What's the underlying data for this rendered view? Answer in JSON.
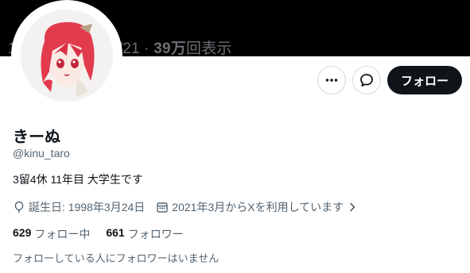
{
  "banner": {
    "overlay_prefix": "1",
    "overlay_date": "/21 · ",
    "views_count": "39万",
    "views_label": "回表示"
  },
  "profile": {
    "display_name": "きーぬ",
    "handle": "@kinu_taro",
    "bio": "3留4休 11年目 大学生です",
    "birthday": "誕生日: 1998年3月24日",
    "joined": "2021年3月からXを利用しています"
  },
  "actions": {
    "follow_label": "フォロー"
  },
  "stats": {
    "following_count": "629",
    "following_label": "フォロー中",
    "followers_count": "661",
    "followers_label": "フォロワー"
  },
  "followed_by_note": "フォローしている人にフォロワーはいません",
  "icons": {
    "more": "more-horizontal-icon",
    "message": "message-icon",
    "birthday": "balloon-icon",
    "joined": "calendar-icon",
    "joined_chevron": "chevron-right-icon"
  },
  "colors": {
    "banner": "#000000",
    "follow_button_bg": "#0f1419",
    "follow_button_text": "#ffffff",
    "secondary_text": "#536471",
    "primary_text": "#0f1419",
    "border": "#cfd9de",
    "avatar_hair": "#e23b4e"
  }
}
